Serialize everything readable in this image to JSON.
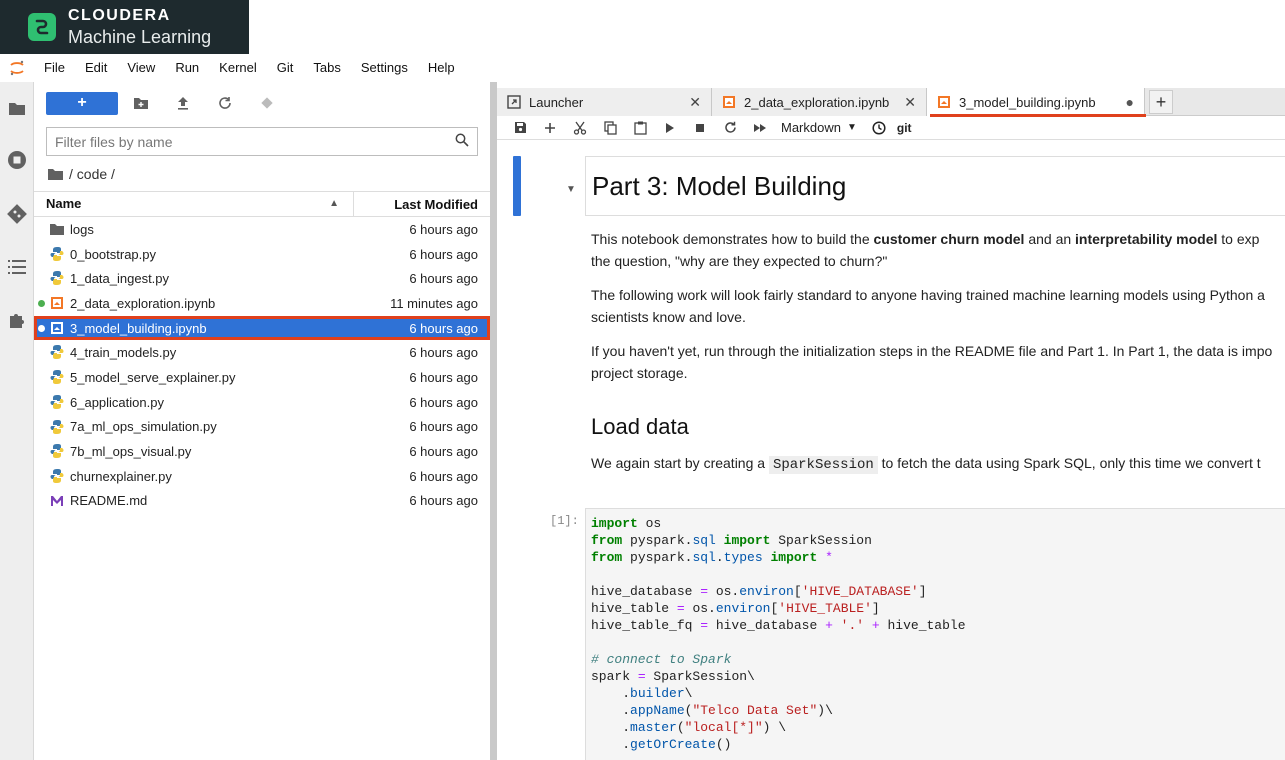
{
  "brand": {
    "line1": "CLOUDERA",
    "line2": "Machine Learning"
  },
  "menu": [
    "File",
    "Edit",
    "View",
    "Run",
    "Kernel",
    "Git",
    "Tabs",
    "Settings",
    "Help"
  ],
  "file_browser": {
    "new_button": "+",
    "search_placeholder": "Filter files by name",
    "breadcrumb": "/ code /",
    "headers": {
      "name": "Name",
      "modified": "Last Modified"
    },
    "files": [
      {
        "name": "logs",
        "modified": "6 hours ago",
        "icon": "folder-icon"
      },
      {
        "name": "0_bootstrap.py",
        "modified": "6 hours ago",
        "icon": "python-icon"
      },
      {
        "name": "1_data_ingest.py",
        "modified": "6 hours ago",
        "icon": "python-icon"
      },
      {
        "name": "2_data_exploration.ipynb",
        "modified": "11 minutes ago",
        "icon": "notebook-icon",
        "running": true
      },
      {
        "name": "3_model_building.ipynb",
        "modified": "6 hours ago",
        "icon": "notebook-icon",
        "running": true,
        "selected": true
      },
      {
        "name": "4_train_models.py",
        "modified": "6 hours ago",
        "icon": "python-icon"
      },
      {
        "name": "5_model_serve_explainer.py",
        "modified": "6 hours ago",
        "icon": "python-icon"
      },
      {
        "name": "6_application.py",
        "modified": "6 hours ago",
        "icon": "python-icon"
      },
      {
        "name": "7a_ml_ops_simulation.py",
        "modified": "6 hours ago",
        "icon": "python-icon"
      },
      {
        "name": "7b_ml_ops_visual.py",
        "modified": "6 hours ago",
        "icon": "python-icon"
      },
      {
        "name": "churnexplainer.py",
        "modified": "6 hours ago",
        "icon": "python-icon"
      },
      {
        "name": "README.md",
        "modified": "6 hours ago",
        "icon": "markdown-icon"
      }
    ]
  },
  "tabs": [
    {
      "label": "Launcher",
      "close": "✕"
    },
    {
      "label": "2_data_exploration.ipynb",
      "close": "✕"
    },
    {
      "label": "3_model_building.ipynb",
      "close": "●",
      "active": true
    }
  ],
  "tab_add": "+",
  "notebook_toolbar": {
    "cell_type": "Markdown",
    "git": "git"
  },
  "notebook": {
    "h1": "Part 3: Model Building",
    "p1_a": "This notebook demonstrates how to build the ",
    "p1_b": "customer churn model",
    "p1_c": " and an ",
    "p1_d": "interpretability model",
    "p1_e": " to exp",
    "p1_line2": "the question, \"why are they expected to churn?\"",
    "p2_line1": "The following work will look fairly standard to anyone having trained machine learning models using Python a",
    "p2_line2": "scientists know and love.",
    "p3_line1": "If you haven't yet, run through the initialization steps in the README file and Part 1. In Part 1, the data is impo",
    "p3_line2": "project storage.",
    "h2": "Load data",
    "p4_a": "We again start by creating a ",
    "p4_code": "SparkSession",
    "p4_b": " to fetch the data using Spark SQL, only this time we convert t",
    "prompt": "[1]:",
    "code": {
      "l1_kw": "import",
      "l1_rest": " os",
      "l2_kw1": "from",
      "l2_mod": " pyspark.",
      "l2_attr": "sql",
      "l2_kw2": " import",
      "l2_rest": " SparkSession",
      "l3_kw1": "from",
      "l3_mod": " pyspark.",
      "l3_attr1": "sql",
      "l3_dot": ".",
      "l3_attr2": "types",
      "l3_kw2": " import",
      "l3_star": " *",
      "l5_a": "hive_database ",
      "l5_eq": "=",
      "l5_b": " os.",
      "l5_attr": "environ",
      "l5_c": "[",
      "l5_str": "'HIVE_DATABASE'",
      "l5_d": "]",
      "l6_a": "hive_table ",
      "l6_eq": "=",
      "l6_b": " os.",
      "l6_attr": "environ",
      "l6_c": "[",
      "l6_str": "'HIVE_TABLE'",
      "l6_d": "]",
      "l7_a": "hive_table_fq ",
      "l7_eq": "=",
      "l7_b": " hive_database ",
      "l7_plus1": "+",
      "l7_str": " '.'",
      "l7_plus2": " +",
      "l7_c": " hive_table",
      "l9_cm": "# connect to Spark",
      "l10_a": "spark ",
      "l10_eq": "=",
      "l10_b": " SparkSession\\",
      "l11_a": "    .",
      "l11_attr": "builder",
      "l11_b": "\\",
      "l12_a": "    .",
      "l12_attr": "appName",
      "l12_b": "(",
      "l12_str": "\"Telco Data Set\"",
      "l12_c": ")\\",
      "l13_a": "    .",
      "l13_attr": "master",
      "l13_b": "(",
      "l13_str": "\"local[*]\"",
      "l13_c": ") \\",
      "l14_a": "    .",
      "l14_attr": "getOrCreate",
      "l14_b": "()"
    }
  },
  "colors": {
    "accent": "#2f72d6",
    "highlight": "#e0401c",
    "brand_bg": "#1e2a2e",
    "brand_green": "#2fbf71",
    "running_dot": "#4caf50"
  }
}
